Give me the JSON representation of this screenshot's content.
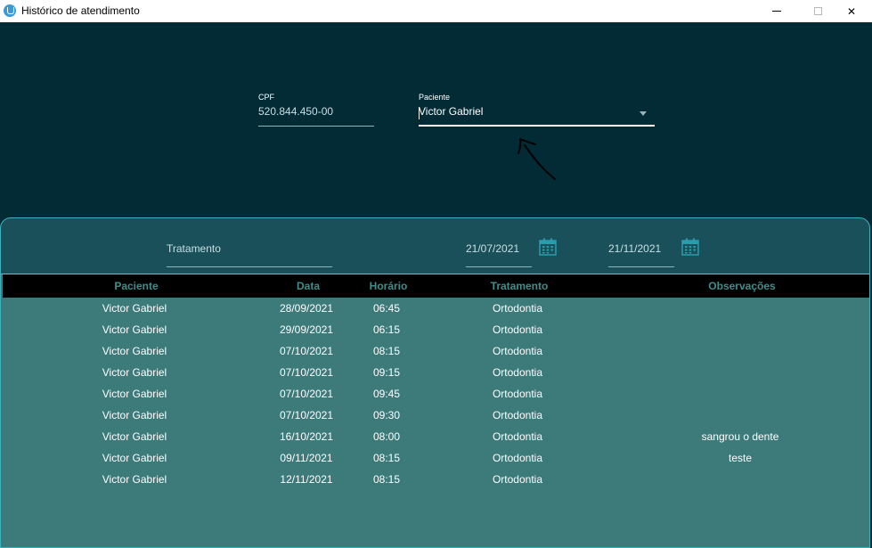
{
  "window": {
    "title": "Histórico de atendimento",
    "minimize_glyph": "",
    "maximize_glyph": "",
    "close_glyph": "✕"
  },
  "form": {
    "cpf_label": "CPF",
    "cpf_value": "520.844.450-00",
    "paciente_label": "Paciente",
    "paciente_value": "Victor Gabriel"
  },
  "filters": {
    "tratamento_placeholder": "Tratamento",
    "date_from": "21/07/2021",
    "date_to": "21/11/2021"
  },
  "table": {
    "headers": {
      "paciente": "Paciente",
      "data": "Data",
      "horario": "Horário",
      "tratamento": "Tratamento",
      "observacoes": "Observações"
    },
    "rows": [
      {
        "paciente": "Victor Gabriel",
        "data": "28/09/2021",
        "horario": "06:45",
        "tratamento": "Ortodontia",
        "observacoes": ""
      },
      {
        "paciente": "Victor Gabriel",
        "data": "29/09/2021",
        "horario": "06:15",
        "tratamento": "Ortodontia",
        "observacoes": ""
      },
      {
        "paciente": "Victor Gabriel",
        "data": "07/10/2021",
        "horario": "08:15",
        "tratamento": "Ortodontia",
        "observacoes": ""
      },
      {
        "paciente": "Victor Gabriel",
        "data": "07/10/2021",
        "horario": "09:15",
        "tratamento": "Ortodontia",
        "observacoes": ""
      },
      {
        "paciente": "Victor Gabriel",
        "data": "07/10/2021",
        "horario": "09:45",
        "tratamento": "Ortodontia",
        "observacoes": ""
      },
      {
        "paciente": "Victor Gabriel",
        "data": "07/10/2021",
        "horario": "09:30",
        "tratamento": "Ortodontia",
        "observacoes": ""
      },
      {
        "paciente": "Victor Gabriel",
        "data": "16/10/2021",
        "horario": "08:00",
        "tratamento": "Ortodontia",
        "observacoes": "sangrou o dente"
      },
      {
        "paciente": "Victor Gabriel",
        "data": "09/11/2021",
        "horario": "08:15",
        "tratamento": "Ortodontia",
        "observacoes": "teste"
      },
      {
        "paciente": "Victor Gabriel",
        "data": "12/11/2021",
        "horario": "08:15",
        "tratamento": "Ortodontia",
        "observacoes": ""
      }
    ]
  },
  "colors": {
    "background": "#032b36",
    "panel": "#1a5059",
    "table_body": "#3d7a7a",
    "header_bg": "#000000",
    "header_text": "#3e8f8b",
    "accent": "#3bb0c2"
  },
  "icons": {
    "app": "tooth-icon",
    "calendar": "calendar-icon",
    "dropdown": "chevron-down-icon"
  }
}
